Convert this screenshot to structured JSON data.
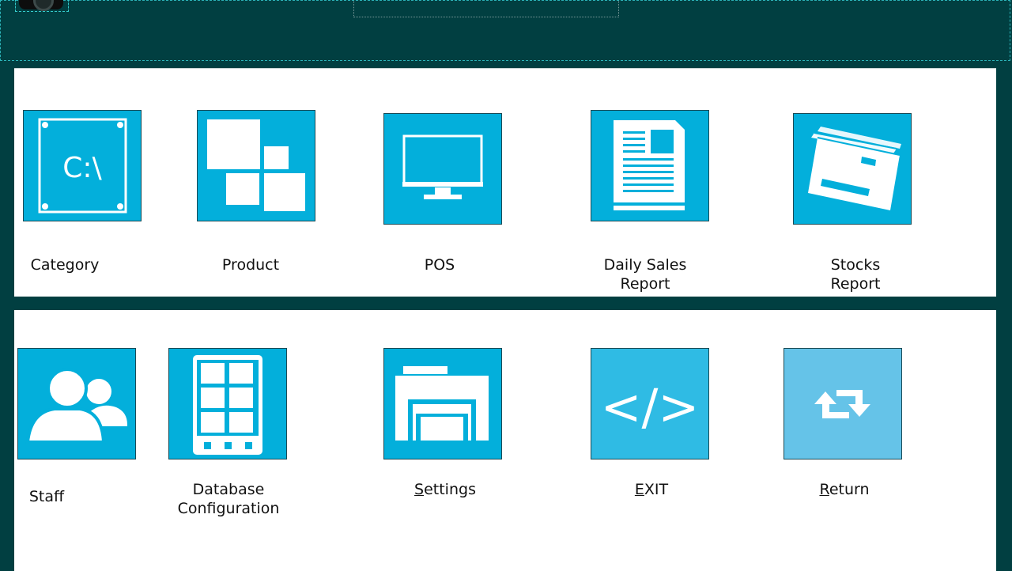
{
  "header": {
    "title": ""
  },
  "menu_top": [
    {
      "id": "category",
      "label_lines": [
        "Category"
      ],
      "icon": "drive-icon",
      "icon_text": "C:\\"
    },
    {
      "id": "product",
      "label_lines": [
        "Product"
      ],
      "icon": "squares-icon"
    },
    {
      "id": "pos",
      "label_lines": [
        "POS"
      ],
      "icon": "monitor-icon"
    },
    {
      "id": "daily-sales-report",
      "label_lines": [
        "Daily Sales",
        "Report"
      ],
      "icon": "newspaper-icon"
    },
    {
      "id": "stocks-report",
      "label_lines": [
        "Stocks",
        "Report"
      ],
      "icon": "envelopes-icon"
    }
  ],
  "menu_bottom": [
    {
      "id": "staff",
      "label_lines": [
        "Staff"
      ],
      "icon": "users-icon"
    },
    {
      "id": "database-configuration",
      "label_lines": [
        "Database",
        "Configuration"
      ],
      "icon": "grid-tablet-icon"
    },
    {
      "id": "settings",
      "mnemonic": "S",
      "rest": "ettings",
      "icon": "printer-icon"
    },
    {
      "id": "exit",
      "mnemonic": "E",
      "rest": "XIT",
      "icon": "code-icon",
      "icon_text": "</>"
    },
    {
      "id": "return",
      "mnemonic": "R",
      "rest": "eturn",
      "icon": "swap-arrows-icon"
    }
  ],
  "colors": {
    "frame": "#013f41",
    "tile": "#03afdb",
    "tile_exit": "#2fbbe4",
    "tile_return": "#65c3e8",
    "panel": "#ffffff"
  }
}
